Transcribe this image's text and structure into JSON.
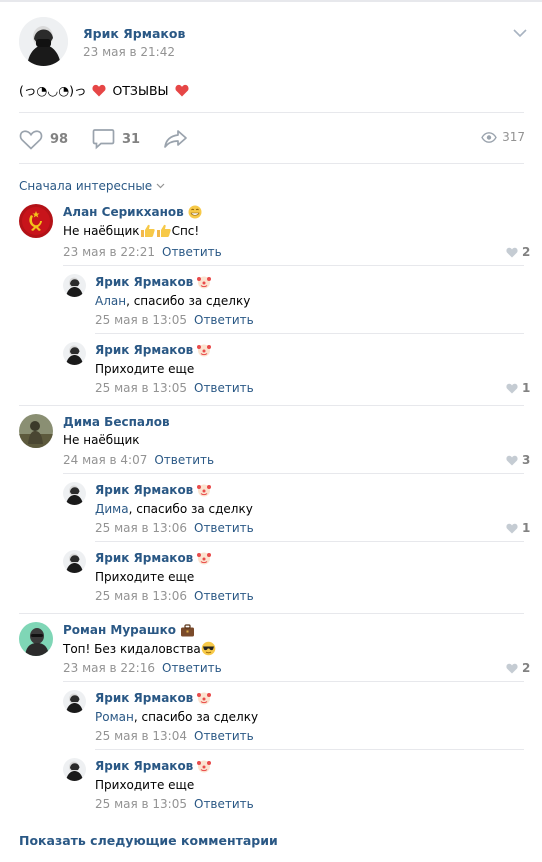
{
  "post": {
    "author": "Ярик Ярмаков",
    "date": "23 мая в 21:42",
    "text_prefix": "(っ◔◡◔)っ",
    "text_main": "ОТЗЫВЫ",
    "likes": "98",
    "comments": "31",
    "views": "317"
  },
  "sort_label": "Сначала интересные",
  "reply_label": "Ответить",
  "comments": [
    {
      "author": "Алан Серикханов",
      "text": "Не наёбщик",
      "text_tail": "Спс!",
      "date": "23 мая в 22:21",
      "likes": "2",
      "replies": [
        {
          "author": "Ярик Ярмаков",
          "mention": "Алан",
          "text": ", спасибо за сделку",
          "date": "25 мая в 13:05",
          "likes": ""
        },
        {
          "author": "Ярик Ярмаков",
          "mention": "",
          "text": "Приходите еще",
          "date": "25 мая в 13:05",
          "likes": "1"
        }
      ]
    },
    {
      "author": "Дима Беспалов",
      "text": "Не наёбщик",
      "date": "24 мая в 4:07",
      "likes": "3",
      "replies": [
        {
          "author": "Ярик Ярмаков",
          "mention": "Дима",
          "text": ", спасибо за сделку",
          "date": "25 мая в 13:06",
          "likes": "1"
        },
        {
          "author": "Ярик Ярмаков",
          "mention": "",
          "text": "Приходите еще",
          "date": "25 мая в 13:06",
          "likes": ""
        }
      ]
    },
    {
      "author": "Роман Мурашко",
      "text": "Топ! Без кидаловства",
      "date": "23 мая в 22:16",
      "likes": "2",
      "replies": [
        {
          "author": "Ярик Ярмаков",
          "mention": "Роман",
          "text": ", спасибо за сделку",
          "date": "25 мая в 13:04",
          "likes": ""
        },
        {
          "author": "Ярик Ярмаков",
          "mention": "",
          "text": "Приходите еще",
          "date": "25 мая в 13:05",
          "likes": ""
        }
      ]
    }
  ],
  "show_more": "Показать следующие комментарии",
  "colors": {
    "link": "#2a5885",
    "meta": "#939393",
    "divider": "#e7e8ec",
    "heart": "#e64646"
  }
}
